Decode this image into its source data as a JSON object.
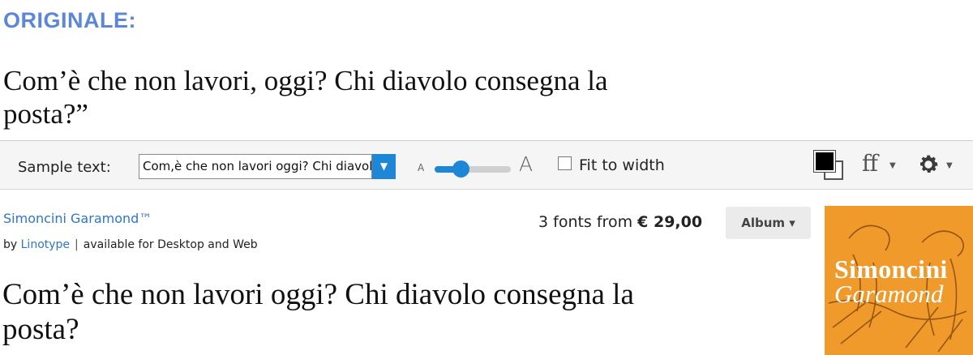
{
  "original": {
    "heading": "ORIGINALE:",
    "sample_line1": "Com’è che non lavori, oggi? Chi diavolo consegna la",
    "sample_line2": "posta?”"
  },
  "toolbar": {
    "sample_label": "Sample text:",
    "sample_value": "Com,è che non lavori oggi? Chi diavolo consegna la posta?",
    "size_slider_level": 0.35,
    "fit_to_width_label": "Fit to width",
    "fit_to_width_checked": false,
    "color_icon": "color-swatch-icon",
    "font_features_label": "ff"
  },
  "font": {
    "name": "Simoncini Garamond™",
    "by_prefix": "by",
    "foundry": "Linotype",
    "availability": "available for Desktop and Web",
    "price_prefix": "3 fonts from",
    "price": "€ 29,00",
    "album_label": "Album ▾",
    "sample_line1": "Com’è che non lavori oggi? Chi diavolo consegna la",
    "sample_line2": "posta?",
    "cover_title1": "Simoncini",
    "cover_title2": "Garamond"
  },
  "colors": {
    "accent": "#1e86d6",
    "link": "#2f76c9",
    "heading": "#5b86d9",
    "cover": "#f09a2c"
  }
}
